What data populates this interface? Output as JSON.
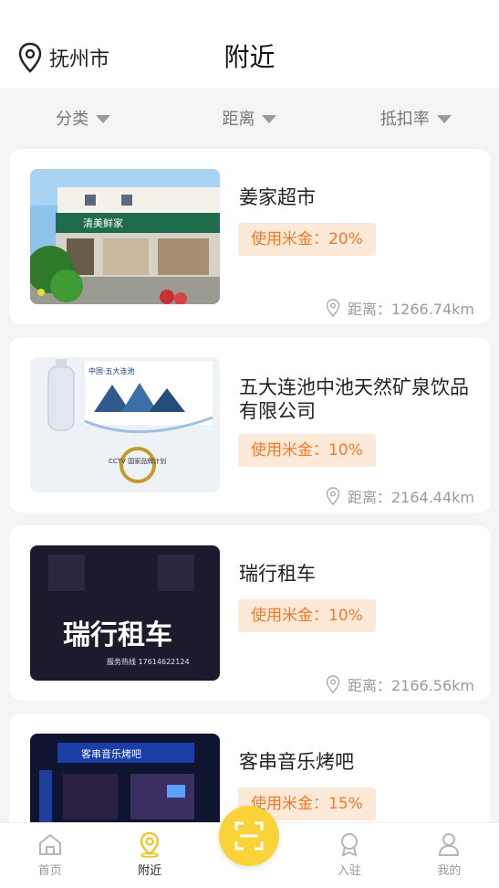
{
  "header": {
    "city": "抚州市",
    "title": "附近"
  },
  "filters": [
    {
      "label": "分类"
    },
    {
      "label": "距离"
    },
    {
      "label": "抵扣率"
    }
  ],
  "stores": [
    {
      "name": "姜家超市",
      "badge": "使用米金：20%",
      "distance": "距离：1266.74km",
      "image_text": "清美鲜家"
    },
    {
      "name": "五大连池中池天然矿泉饮品有限公司",
      "badge": "使用米金：10%",
      "distance": "距离：2164.44km",
      "image_text": "中国·五大连池",
      "image_text2": "CCTV 国家品牌计划"
    },
    {
      "name": "瑞行租车",
      "badge": "使用米金：10%",
      "distance": "距离：2166.56km",
      "image_text": "瑞行租车",
      "image_text2": "服务热线 17614622124"
    },
    {
      "name": "客串音乐烤吧",
      "badge": "使用米金：15%",
      "distance": "",
      "image_text": "客串音乐烤吧"
    }
  ],
  "tabbar": {
    "items": [
      {
        "label": "首页",
        "icon": "home-icon"
      },
      {
        "label": "附近",
        "icon": "location-icon"
      },
      {
        "label": "入驻",
        "icon": "badge-icon"
      },
      {
        "label": "我的",
        "icon": "user-icon"
      }
    ],
    "center_icon": "scan-icon"
  },
  "colors": {
    "accent": "#f9d338",
    "badge_bg": "#fde9d8",
    "badge_text": "#f07a2b"
  }
}
